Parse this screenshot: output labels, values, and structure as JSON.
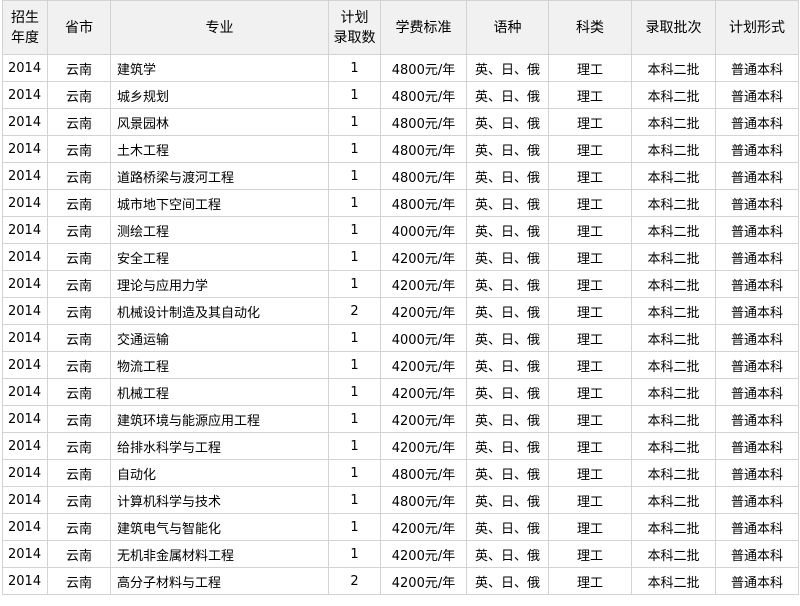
{
  "headers": {
    "year": [
      "招生",
      "年度"
    ],
    "province": "省市",
    "major": "专业",
    "quota": [
      "计划",
      "录取数"
    ],
    "tuition": "学费标准",
    "language": "语种",
    "category": "科类",
    "batch": "录取批次",
    "plan_type": "计划形式"
  },
  "rows": [
    {
      "year": "2014",
      "province": "云南",
      "major": "建筑学",
      "quota": "1",
      "tuition": "4800元/年",
      "language": "英、日、俄",
      "category": "理工",
      "batch": "本科二批",
      "plan_type": "普通本科"
    },
    {
      "year": "2014",
      "province": "云南",
      "major": "城乡规划",
      "quota": "1",
      "tuition": "4800元/年",
      "language": "英、日、俄",
      "category": "理工",
      "batch": "本科二批",
      "plan_type": "普通本科"
    },
    {
      "year": "2014",
      "province": "云南",
      "major": "风景园林",
      "quota": "1",
      "tuition": "4800元/年",
      "language": "英、日、俄",
      "category": "理工",
      "batch": "本科二批",
      "plan_type": "普通本科"
    },
    {
      "year": "2014",
      "province": "云南",
      "major": "土木工程",
      "quota": "1",
      "tuition": "4800元/年",
      "language": "英、日、俄",
      "category": "理工",
      "batch": "本科二批",
      "plan_type": "普通本科"
    },
    {
      "year": "2014",
      "province": "云南",
      "major": "道路桥梁与渡河工程",
      "quota": "1",
      "tuition": "4800元/年",
      "language": "英、日、俄",
      "category": "理工",
      "batch": "本科二批",
      "plan_type": "普通本科"
    },
    {
      "year": "2014",
      "province": "云南",
      "major": "城市地下空间工程",
      "quota": "1",
      "tuition": "4800元/年",
      "language": "英、日、俄",
      "category": "理工",
      "batch": "本科二批",
      "plan_type": "普通本科"
    },
    {
      "year": "2014",
      "province": "云南",
      "major": "测绘工程",
      "quota": "1",
      "tuition": "4000元/年",
      "language": "英、日、俄",
      "category": "理工",
      "batch": "本科二批",
      "plan_type": "普通本科"
    },
    {
      "year": "2014",
      "province": "云南",
      "major": "安全工程",
      "quota": "1",
      "tuition": "4200元/年",
      "language": "英、日、俄",
      "category": "理工",
      "batch": "本科二批",
      "plan_type": "普通本科"
    },
    {
      "year": "2014",
      "province": "云南",
      "major": "理论与应用力学",
      "quota": "1",
      "tuition": "4200元/年",
      "language": "英、日、俄",
      "category": "理工",
      "batch": "本科二批",
      "plan_type": "普通本科"
    },
    {
      "year": "2014",
      "province": "云南",
      "major": "机械设计制造及其自动化",
      "quota": "2",
      "tuition": "4200元/年",
      "language": "英、日、俄",
      "category": "理工",
      "batch": "本科二批",
      "plan_type": "普通本科"
    },
    {
      "year": "2014",
      "province": "云南",
      "major": "交通运输",
      "quota": "1",
      "tuition": "4000元/年",
      "language": "英、日、俄",
      "category": "理工",
      "batch": "本科二批",
      "plan_type": "普通本科"
    },
    {
      "year": "2014",
      "province": "云南",
      "major": "物流工程",
      "quota": "1",
      "tuition": "4200元/年",
      "language": "英、日、俄",
      "category": "理工",
      "batch": "本科二批",
      "plan_type": "普通本科"
    },
    {
      "year": "2014",
      "province": "云南",
      "major": "机械工程",
      "quota": "1",
      "tuition": "4200元/年",
      "language": "英、日、俄",
      "category": "理工",
      "batch": "本科二批",
      "plan_type": "普通本科"
    },
    {
      "year": "2014",
      "province": "云南",
      "major": "建筑环境与能源应用工程",
      "quota": "1",
      "tuition": "4200元/年",
      "language": "英、日、俄",
      "category": "理工",
      "batch": "本科二批",
      "plan_type": "普通本科"
    },
    {
      "year": "2014",
      "province": "云南",
      "major": "给排水科学与工程",
      "quota": "1",
      "tuition": "4200元/年",
      "language": "英、日、俄",
      "category": "理工",
      "batch": "本科二批",
      "plan_type": "普通本科"
    },
    {
      "year": "2014",
      "province": "云南",
      "major": "自动化",
      "quota": "1",
      "tuition": "4800元/年",
      "language": "英、日、俄",
      "category": "理工",
      "batch": "本科二批",
      "plan_type": "普通本科"
    },
    {
      "year": "2014",
      "province": "云南",
      "major": "计算机科学与技术",
      "quota": "1",
      "tuition": "4800元/年",
      "language": "英、日、俄",
      "category": "理工",
      "batch": "本科二批",
      "plan_type": "普通本科"
    },
    {
      "year": "2014",
      "province": "云南",
      "major": "建筑电气与智能化",
      "quota": "1",
      "tuition": "4200元/年",
      "language": "英、日、俄",
      "category": "理工",
      "batch": "本科二批",
      "plan_type": "普通本科"
    },
    {
      "year": "2014",
      "province": "云南",
      "major": "无机非金属材料工程",
      "quota": "1",
      "tuition": "4200元/年",
      "language": "英、日、俄",
      "category": "理工",
      "batch": "本科二批",
      "plan_type": "普通本科"
    },
    {
      "year": "2014",
      "province": "云南",
      "major": "高分子材料与工程",
      "quota": "2",
      "tuition": "4200元/年",
      "language": "英、日、俄",
      "category": "理工",
      "batch": "本科二批",
      "plan_type": "普通本科"
    }
  ]
}
